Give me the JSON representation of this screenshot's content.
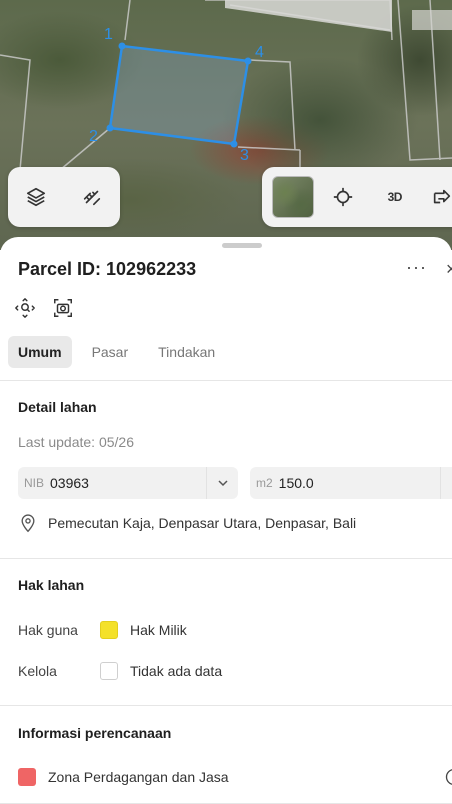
{
  "map": {
    "vertices": [
      "1",
      "2",
      "3",
      "4"
    ],
    "toolbar_left": {
      "layers_icon": "layers-icon",
      "measure_icon": "ruler-icon"
    },
    "toolbar_right": {
      "basemap_icon": "satellite-thumbnail",
      "locate_icon": "crosshair-icon",
      "label_3d": "3D",
      "share_icon": "share-icon"
    }
  },
  "sheet": {
    "title": "Parcel ID: 102962233",
    "more": "···",
    "close": "×",
    "tabs": [
      {
        "label": "Umum",
        "active": true
      },
      {
        "label": "Pasar",
        "active": false
      },
      {
        "label": "Tindakan",
        "active": false
      }
    ],
    "detail": {
      "title": "Detail lahan",
      "last_update": "Last update: 05/26",
      "nib_prefix": "NIB",
      "nib_value": "03963",
      "area_prefix": "m2",
      "area_value": "150.0",
      "address": "Pemecutan Kaja, Denpasar Utara, Denpasar, Bali"
    },
    "rights": {
      "title": "Hak lahan",
      "rows": [
        {
          "label": "Hak guna",
          "value": "Hak Milik",
          "color": "#f4e12a"
        },
        {
          "label": "Kelola",
          "value": "Tidak ada data",
          "color": "#ffffff"
        }
      ]
    },
    "planning": {
      "title": "Informasi perencanaan",
      "zone": "Zona Perdagangan dan Jasa",
      "zone_color": "#ef6565"
    }
  }
}
